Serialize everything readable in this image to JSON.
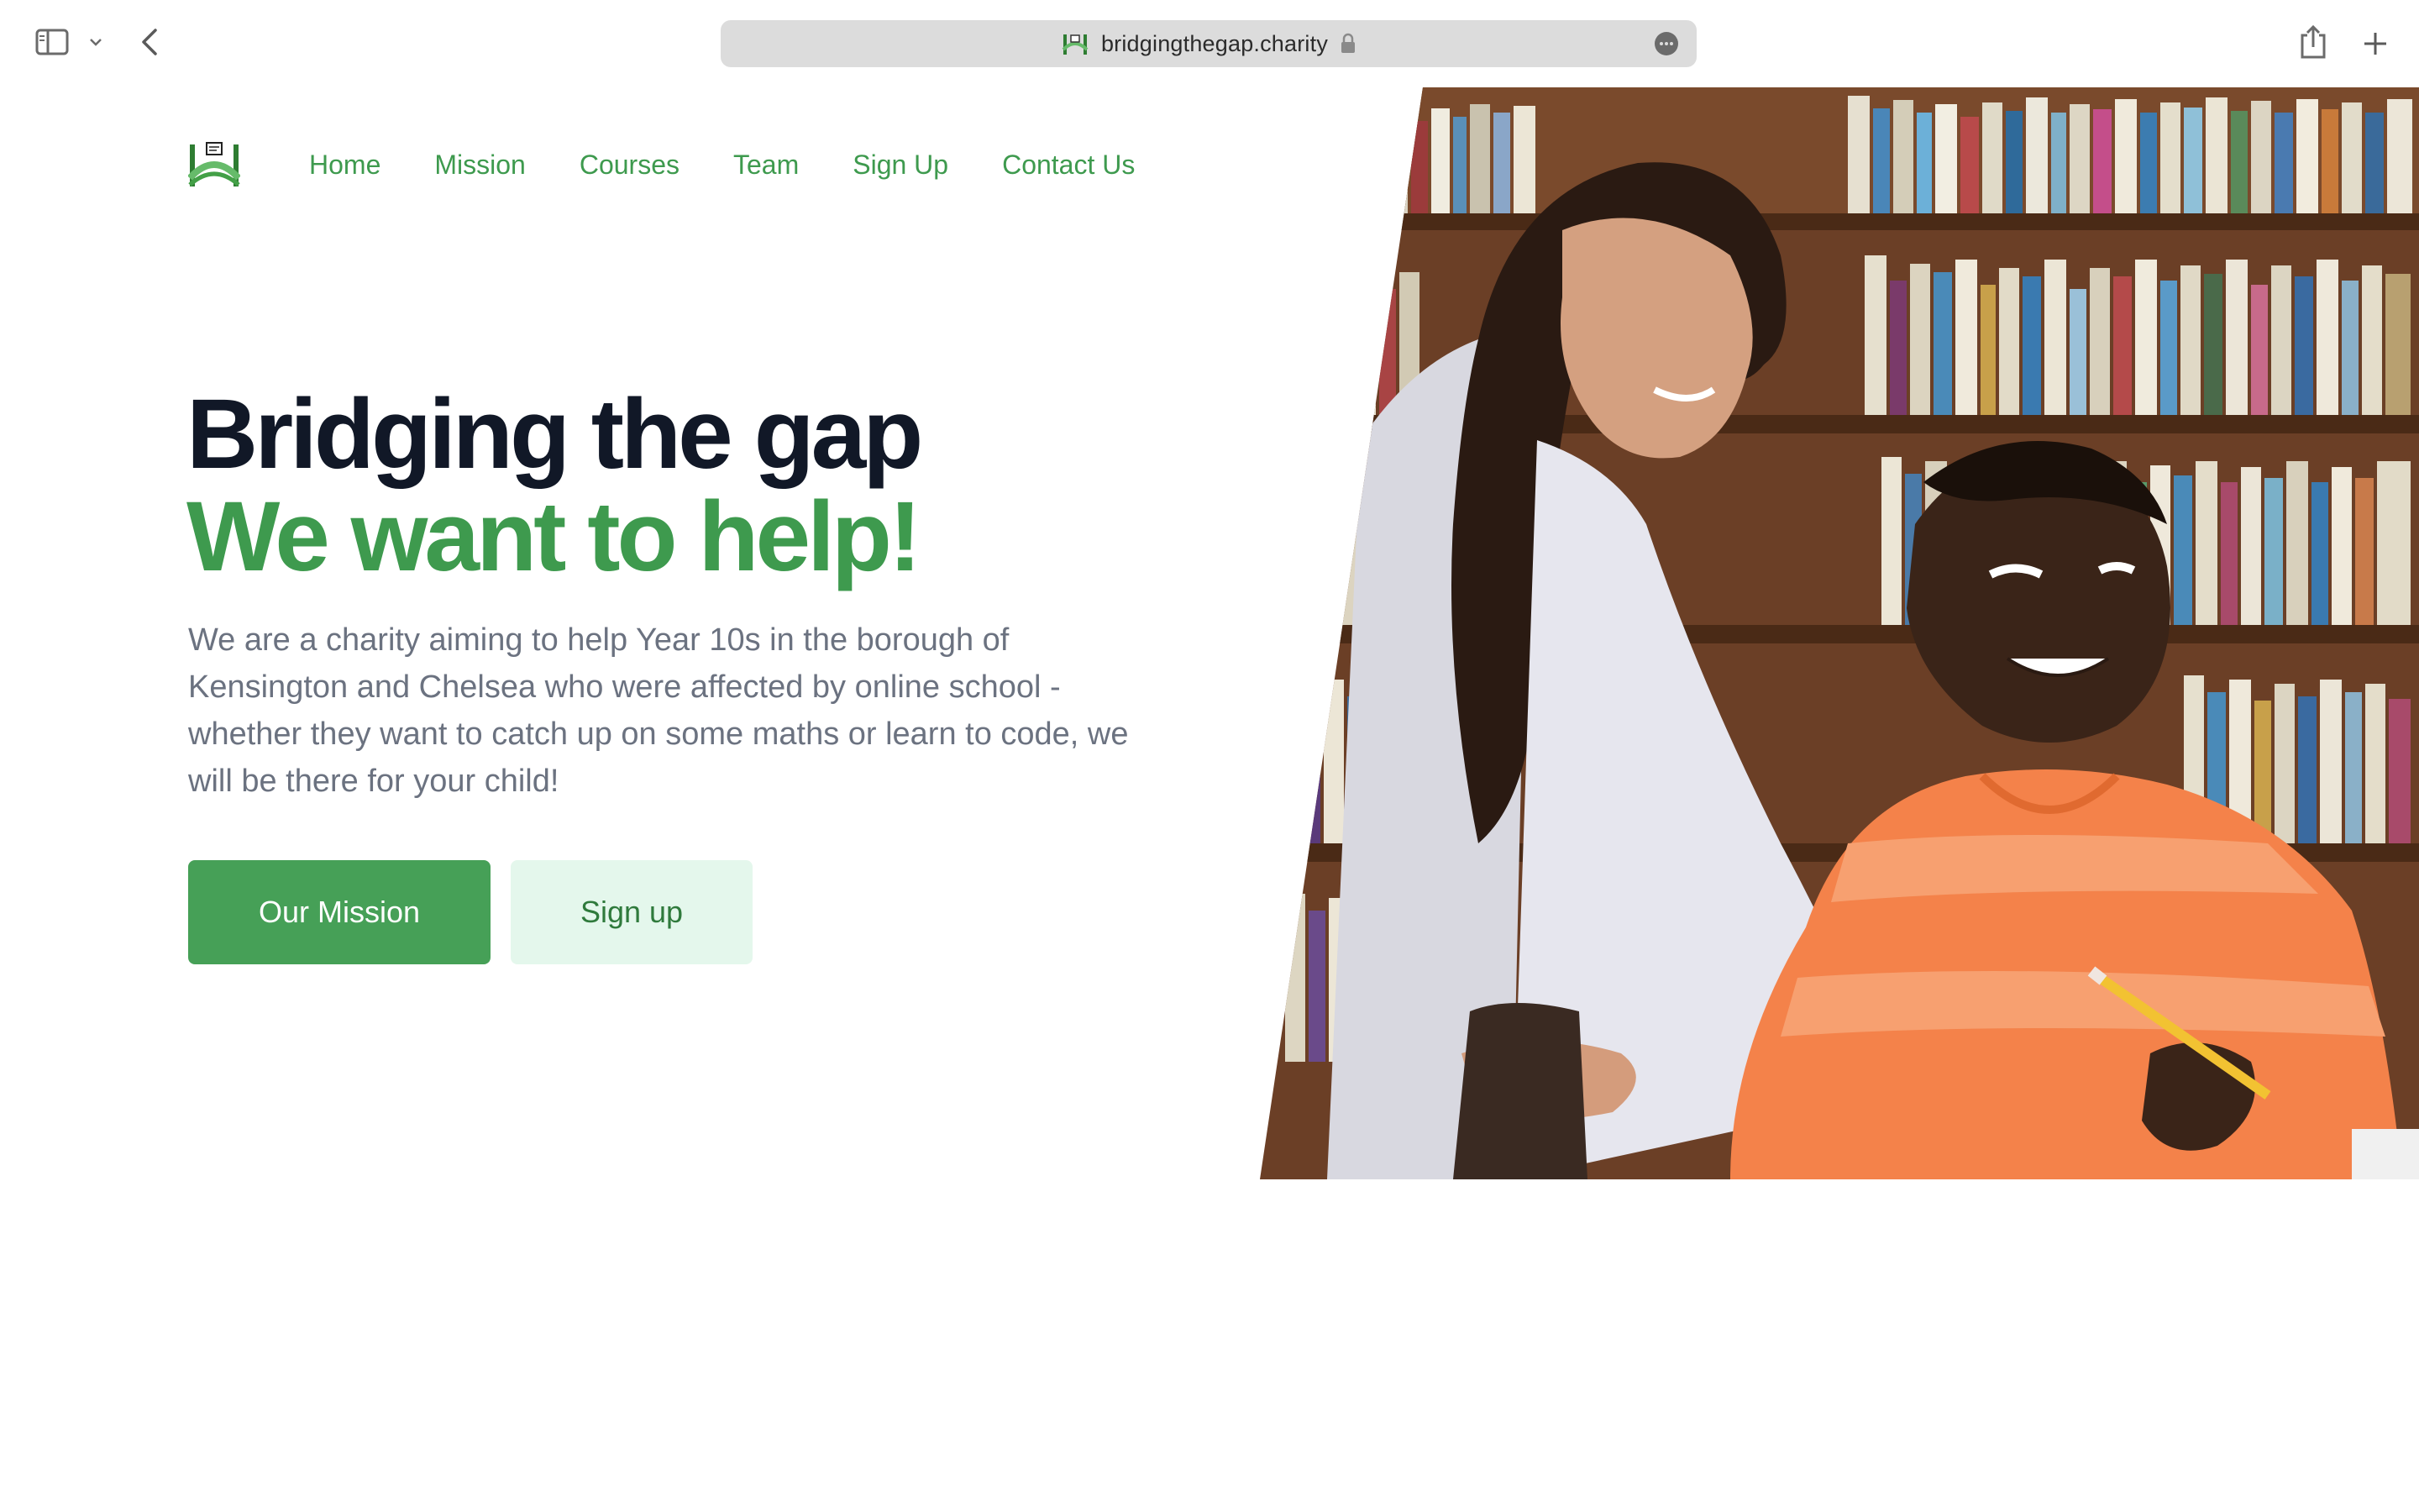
{
  "browser": {
    "url": "bridgingthegap.charity"
  },
  "nav": {
    "items": [
      {
        "label": "Home"
      },
      {
        "label": "Mission"
      },
      {
        "label": "Courses"
      },
      {
        "label": "Team"
      },
      {
        "label": "Sign Up"
      },
      {
        "label": "Contact Us"
      }
    ]
  },
  "hero": {
    "title_line1": "Bridging the gap",
    "title_line2": "We want to help!",
    "description": "We are a charity aiming to help Year 10s in the borough of Kensington and Chelsea who were affected by online school - whether they want to catch up on some maths or learn to code, we will be there for your child!",
    "primary_button": "Our Mission",
    "secondary_button": "Sign up"
  },
  "colors": {
    "brand_green": "#3e9a4e",
    "button_green": "#46a057",
    "button_light": "#e4f7ec",
    "heading_dark": "#111827",
    "body_gray": "#6b7280"
  }
}
